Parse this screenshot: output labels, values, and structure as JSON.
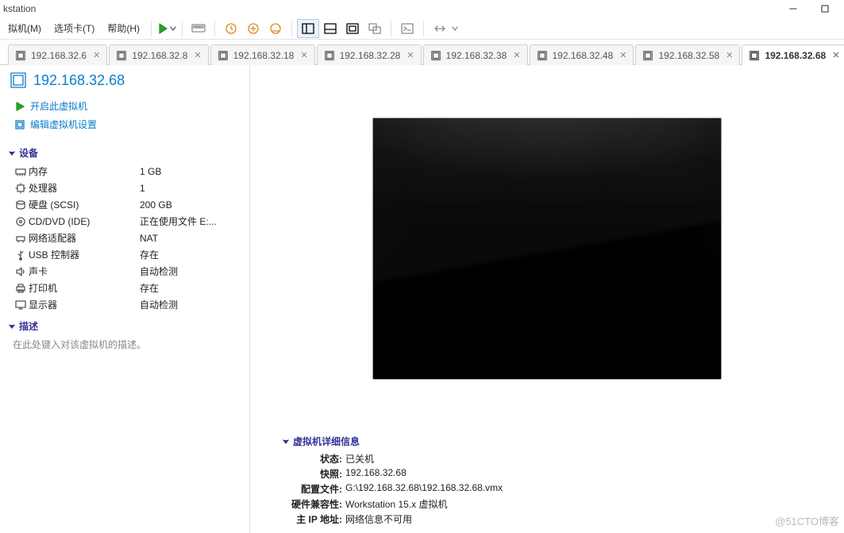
{
  "window": {
    "title_fragment": "kstation"
  },
  "menu": {
    "m1": "拟机(M)",
    "m2": "选项卡(T)",
    "m3": "帮助(H)"
  },
  "tabs": [
    {
      "label": "192.168.32.6"
    },
    {
      "label": "192.168.32.8"
    },
    {
      "label": "192.168.32.18"
    },
    {
      "label": "192.168.32.28"
    },
    {
      "label": "192.168.32.38"
    },
    {
      "label": "192.168.32.48"
    },
    {
      "label": "192.168.32.58"
    },
    {
      "label": "192.168.32.68"
    }
  ],
  "vm": {
    "title": "192.168.32.68",
    "actions": {
      "power_on": "开启此虚拟机",
      "edit_settings": "编辑虚拟机设置"
    }
  },
  "sections": {
    "devices": "设备",
    "description": "描述"
  },
  "devices": [
    {
      "label": "内存",
      "value": "1 GB"
    },
    {
      "label": "处理器",
      "value": "1"
    },
    {
      "label": "硬盘 (SCSI)",
      "value": "200 GB"
    },
    {
      "label": "CD/DVD (IDE)",
      "value": "正在使用文件 E:..."
    },
    {
      "label": "网络适配器",
      "value": "NAT"
    },
    {
      "label": "USB 控制器",
      "value": "存在"
    },
    {
      "label": "声卡",
      "value": "自动检测"
    },
    {
      "label": "打印机",
      "value": "存在"
    },
    {
      "label": "显示器",
      "value": "自动检测"
    }
  ],
  "description_placeholder": "在此处键入对该虚拟机的描述。",
  "details": {
    "heading": "虚拟机详细信息",
    "rows": {
      "state_label": "状态:",
      "state_val": "已关机",
      "snap_label": "快照:",
      "snap_val": "192.168.32.68",
      "cfg_label": "配置文件:",
      "cfg_val": "G:\\192.168.32.68\\192.168.32.68.vmx",
      "hw_label": "硬件兼容性:",
      "hw_val": "Workstation 15.x 虚拟机",
      "ip_label": "主 IP 地址:",
      "ip_val": "网络信息不可用"
    }
  },
  "watermark": "@51CTO博客"
}
